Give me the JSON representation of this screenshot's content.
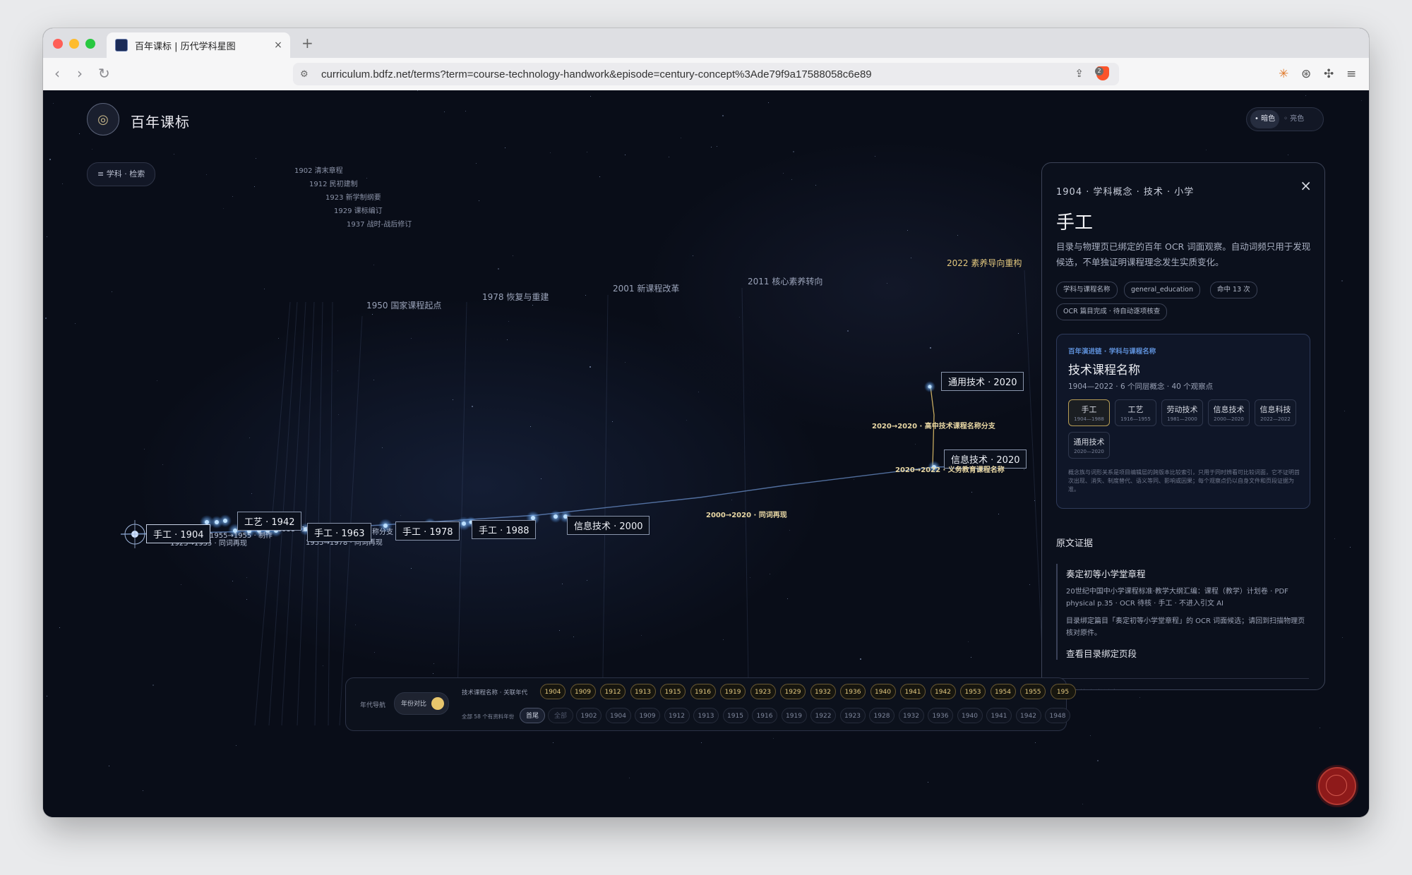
{
  "browser": {
    "tab_title": "百年课标 | 历代学科星图",
    "tab_close": "×",
    "new_tab": "+",
    "url": "curriculum.bdfz.net/terms?term=course-technology-handwork&episode=century-concept%3Ade79f9a17588058c6e89",
    "back": "‹",
    "forward": "›",
    "reload": "↻",
    "share": "⇪",
    "brave_count": "2",
    "menu": "≡"
  },
  "app": {
    "brand": "百年课标",
    "theme_dark": "• 暗色",
    "theme_light": "◦ 亮色",
    "subject_search": "≡  学科 · 检索"
  },
  "legend": [
    "1902  清末章程",
    "1912  民初建制",
    "1923  新学制纲要",
    "1929  课标编订",
    "1937  战时-战后修订"
  ],
  "eras": [
    "1950  国家课程起点",
    "1978  恢复与重建",
    "2001  新课程改革",
    "2011  核心素养转向",
    "2022  素养导向重构"
  ],
  "nodes": {
    "n1904": "手工 · 1904",
    "n1942": "工艺 · 1942",
    "n1963": "手工 · 1963",
    "n1978": "手工 · 1978",
    "n1988": "手工 · 1988",
    "n2000": "信息技术 · 2000",
    "n2020a": "通用技术 · 2020",
    "n2020b": "信息技术 · 2020"
  },
  "small_labels": {
    "s1": "1955→1955 · 制作",
    "s2": "1923→1955 · 同词再现",
    "s3": "1955→19",
    "s4": "1955→1978 · 同词再现",
    "s5": "名称分支"
  },
  "link_labels": {
    "l1": "2000→2020 · 同词再现",
    "l2": "2020→2020 · 高中技术课程名称分支",
    "l3": "2020→2022 · 义务教育课程名称"
  },
  "panel": {
    "meta": "1904 · 学科概念 · 技术 · 小学",
    "close": "×",
    "title": "手工",
    "desc": "目录与物理页已绑定的百年 OCR 词面观察。自动词频只用于发现候选，不单独证明课程理念发生实质变化。",
    "tags": [
      "学科与课程名称",
      "general_education",
      "命中 13 次",
      "OCR 篇目完成 · 待自动逐项核查"
    ],
    "evolution": {
      "kicker": "百年演进链 · 学科与课程名称",
      "title": "技术课程名称",
      "sub": "1904—2022 · 6 个同层概念 · 40 个观察点",
      "chips": [
        {
          "name": "手工",
          "years": "1904—1988"
        },
        {
          "name": "工艺",
          "years": "1916—1955"
        },
        {
          "name": "劳动技术",
          "years": "1981—2000"
        },
        {
          "name": "信息技术",
          "years": "2000—2020"
        },
        {
          "name": "信息科技",
          "years": "2022—2022"
        },
        {
          "name": "通用技术",
          "years": "2020—2020"
        }
      ],
      "note": "概念族与词形关系是项目编辑层的跨版本比较索引，只用于同时辨看可比较词面，它不证明首次出现、消失、制度替代、语义等同、影响或因果；每个观察点仍以自身文件和页段证据为准。"
    },
    "evidence_heading": "原文证据",
    "evidence": {
      "title": "奏定初等小学堂章程",
      "source": "20世纪中国中小学课程标准·教学大纲汇编：课程（教学）计划卷 · PDF physical p.35 · OCR 待核 · 手工 · 不进入引文 AI",
      "note": "目录绑定篇目「奏定初等小学堂章程」的 OCR 词面候选；请回到扫描物理页核对原件。",
      "link": "查看目录绑定页段"
    },
    "evidence2_title": "奏定初等小学堂章程"
  },
  "bottom_nav": {
    "label": "年代导航",
    "toggle_text": "年份对比",
    "row1_label": "技术课程名称 · 关联年代",
    "row2_label": "全部 58 个有资料年份",
    "gold_years": [
      "1904",
      "1909",
      "1912",
      "1913",
      "1915",
      "1916",
      "1919",
      "1923",
      "1929",
      "1932",
      "1936",
      "1940",
      "1941",
      "1942",
      "1953",
      "1954",
      "1955",
      "195"
    ],
    "chip_first": "首尾",
    "chip_all": "全部",
    "all_years": [
      "1902",
      "1904",
      "1909",
      "1912",
      "1913",
      "1915",
      "1916",
      "1919",
      "1922",
      "1923",
      "1928",
      "1932",
      "1936",
      "1940",
      "1941",
      "1942",
      "1948"
    ]
  },
  "colors": {
    "background": "#090d18",
    "accent_gold": "#e3c87e",
    "node_blue": "#5da8ff",
    "kicker_blue": "#5d8fd8",
    "seal_red": "#8e1a1a"
  }
}
